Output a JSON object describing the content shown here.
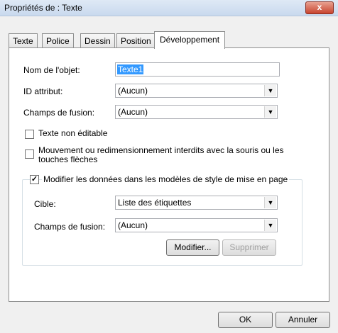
{
  "window": {
    "title": "Propriétés de : Texte",
    "close_label": "x"
  },
  "tabs": [
    {
      "label": "Texte"
    },
    {
      "label": "Police"
    },
    {
      "label": "Dessin"
    },
    {
      "label": "Position"
    },
    {
      "label": "Développement"
    }
  ],
  "form": {
    "object_name_label": "Nom de l'objet:",
    "object_name_value": "Texte1",
    "id_attr_label": "ID attribut:",
    "id_attr_value": "(Aucun)",
    "merge_field_label": "Champs de fusion:",
    "merge_field_value": "(Aucun)",
    "non_editable_label": "Texte non éditable",
    "no_move_label_line1": "Mouvement ou redimensionnement interdits avec la souris ou les",
    "no_move_label_line2": "touches flèches"
  },
  "group": {
    "checkbox_label": "Modifier les données dans les modèles de style de mise en page",
    "target_label": "Cible:",
    "target_value": "Liste des étiquettes",
    "merge_field_label": "Champs de fusion:",
    "merge_field_value": "(Aucun)",
    "modify_button": "Modifier...",
    "delete_button": "Supprimer"
  },
  "footer": {
    "ok_label": "OK",
    "cancel_label": "Annuler"
  }
}
